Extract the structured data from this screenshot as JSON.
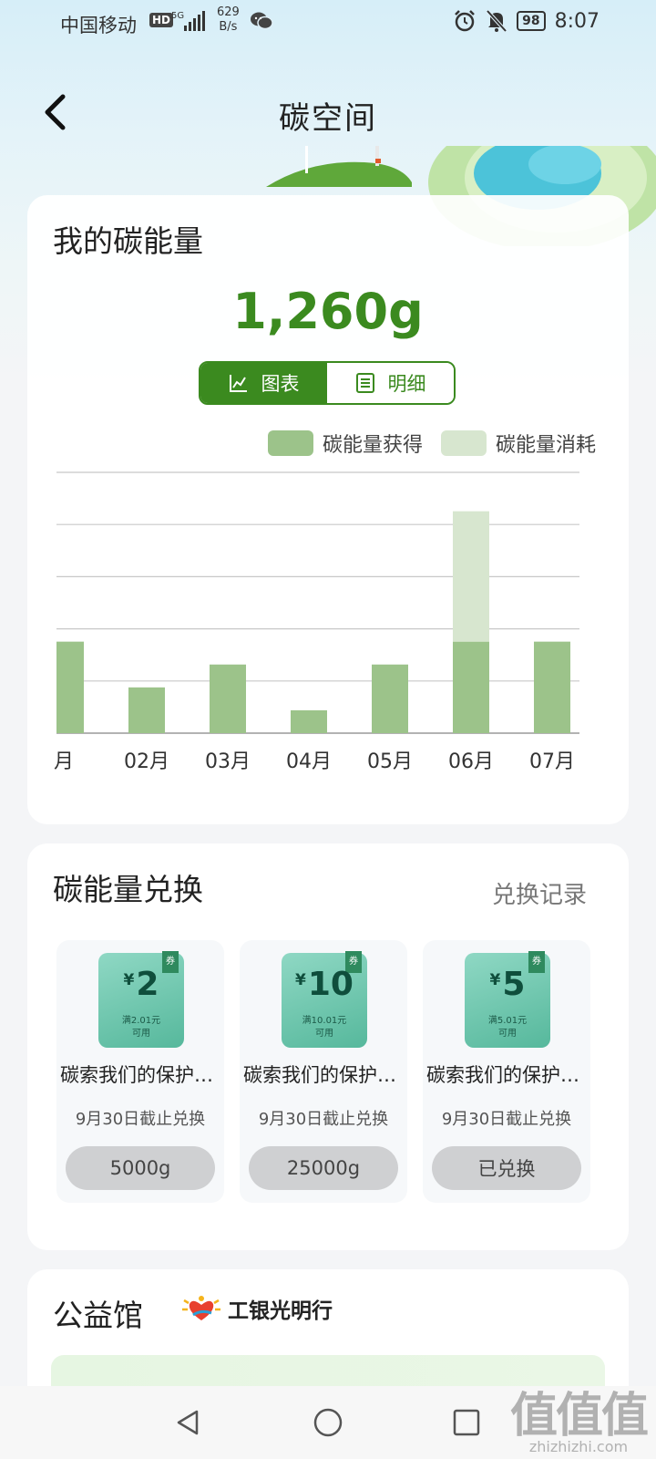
{
  "status_bar": {
    "carrier": "中国移动",
    "hd": "HD",
    "network": "5G",
    "speed_value": "629",
    "speed_unit": "B/s",
    "battery": "98",
    "time": "8:07"
  },
  "header": {
    "title": "碳空间"
  },
  "energy_card": {
    "title": "我的碳能量",
    "value": "1,260g",
    "tabs": [
      {
        "label": "图表",
        "icon": "line-chart-icon",
        "active": true
      },
      {
        "label": "明细",
        "icon": "list-icon",
        "active": false
      }
    ]
  },
  "chart_data": {
    "type": "bar",
    "stacked": true,
    "categories": [
      "月",
      "02月",
      "03月",
      "04月",
      "05月",
      "06月",
      "07月"
    ],
    "series": [
      {
        "name": "碳能量获得",
        "values": [
          2,
          1,
          1.5,
          0.5,
          1.5,
          2,
          2
        ],
        "color": "#9cc38a"
      },
      {
        "name": "碳能量消耗",
        "values": [
          0,
          0,
          0,
          0,
          0,
          2.85,
          0
        ],
        "color": "#d7e6cf"
      }
    ],
    "ylim": [
      0,
      5.7
    ],
    "grid": true,
    "legend_position": "top-right"
  },
  "exchange_card": {
    "title": "碳能量兑换",
    "records_link": "兑换记录",
    "coupons": [
      {
        "currency": "¥",
        "amount": "2",
        "condition": "满2.01元",
        "usable": "可用",
        "tag": "券",
        "name": "碳索我们的保护…",
        "deadline": "9月30日截止兑换",
        "button": "5000g"
      },
      {
        "currency": "¥",
        "amount": "10",
        "condition": "满10.01元",
        "usable": "可用",
        "tag": "券",
        "name": "碳索我们的保护…",
        "deadline": "9月30日截止兑换",
        "button": "25000g"
      },
      {
        "currency": "¥",
        "amount": "5",
        "condition": "满5.01元",
        "usable": "可用",
        "tag": "券",
        "name": "碳索我们的保护…",
        "deadline": "9月30日截止兑换",
        "button": "已兑换"
      }
    ]
  },
  "charity_card": {
    "title": "公益馆",
    "partner": "工银光明行"
  },
  "watermark": {
    "big": "值值值",
    "small": "zhizhizhi.com"
  },
  "colors": {
    "accent": "#3b8a1f",
    "gained": "#9cc38a",
    "consumed": "#d7e6cf"
  }
}
